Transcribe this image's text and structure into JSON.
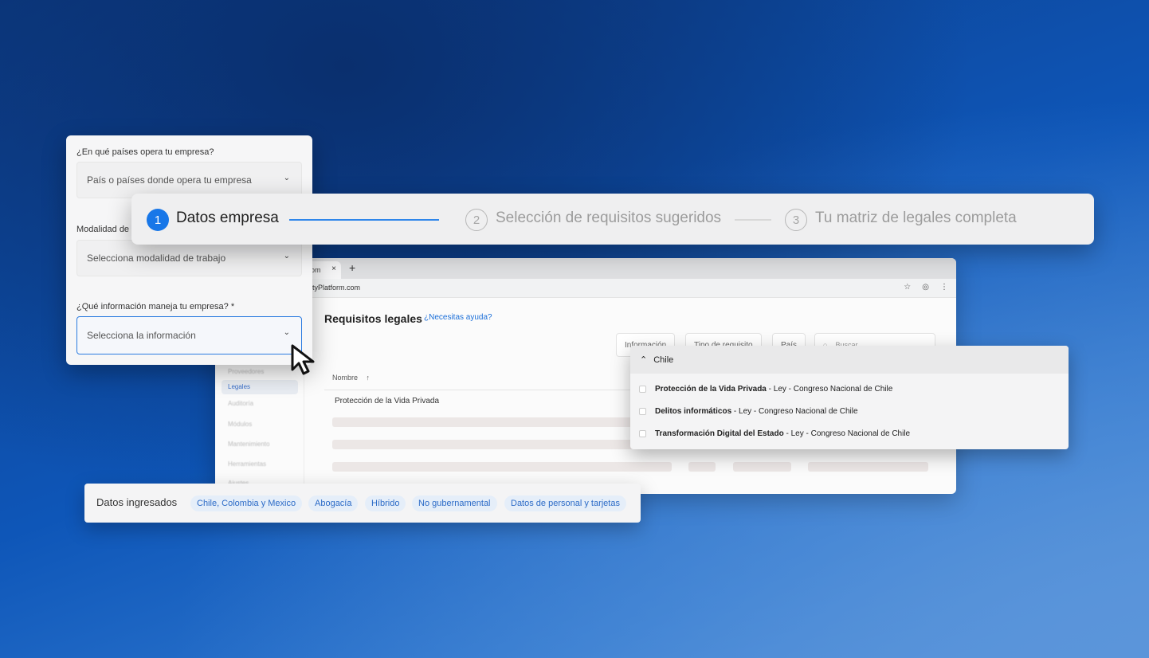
{
  "browser": {
    "tab_title": "om",
    "tab_close": "×",
    "new_tab": "+",
    "url": "urityPlatform.com",
    "icons": [
      "star-icon",
      "profile-icon",
      "menu-dots-icon"
    ],
    "sidebar": {
      "items": [
        "Proveedores",
        "Legales",
        "Auditoría",
        "Módulos",
        "Mantenimiento",
        "Herramientas",
        "Ajustes"
      ],
      "active_item": "Legales"
    },
    "page": {
      "title": "Requisitos legales",
      "help_link": "¿Necesitas ayuda?",
      "filters": [
        "Información",
        "Tipo de requisito",
        "País"
      ],
      "search_placeholder": "Buscar",
      "table": {
        "column_name": "Nombre",
        "rows": [
          "Protección de la Vida Privada"
        ]
      }
    }
  },
  "form": {
    "q1_label": "¿En qué países opera tu empresa?",
    "q1_placeholder": "País o países donde opera tu empresa",
    "q2_label": "Modalidad de",
    "q2_placeholder": "Selecciona modalidad de trabajo",
    "q3_label": "¿Qué información maneja tu empresa? *",
    "q3_placeholder": "Selecciona la información"
  },
  "stepper": {
    "steps": [
      {
        "number": "1",
        "label": "Datos empresa",
        "state": "active"
      },
      {
        "number": "2",
        "label": "Selección de requisitos sugeridos",
        "state": "inactive"
      },
      {
        "number": "3",
        "label": "Tu matriz de legales completa",
        "state": "inactive"
      }
    ]
  },
  "dropdown": {
    "group": "Chile",
    "items": [
      {
        "name": "Protección de la Vida Privada",
        "detail": " - Ley - Congreso Nacional de Chile"
      },
      {
        "name": "Delitos informáticos",
        "detail": " - Ley - Congreso Nacional de Chile"
      },
      {
        "name": "Transformación Digital del Estado",
        "detail": " - Ley - Congreso Nacional de Chile"
      }
    ]
  },
  "datos": {
    "label": "Datos ingresados",
    "chips": [
      "Chile, Colombia y Mexico",
      "Abogacía",
      "Híbrido",
      "No gubernamental",
      "Datos de personal y tarjetas"
    ]
  },
  "colors": {
    "accent": "#1877e8",
    "chip_text": "#2c6bc7",
    "chip_bg": "#e5eef9"
  }
}
